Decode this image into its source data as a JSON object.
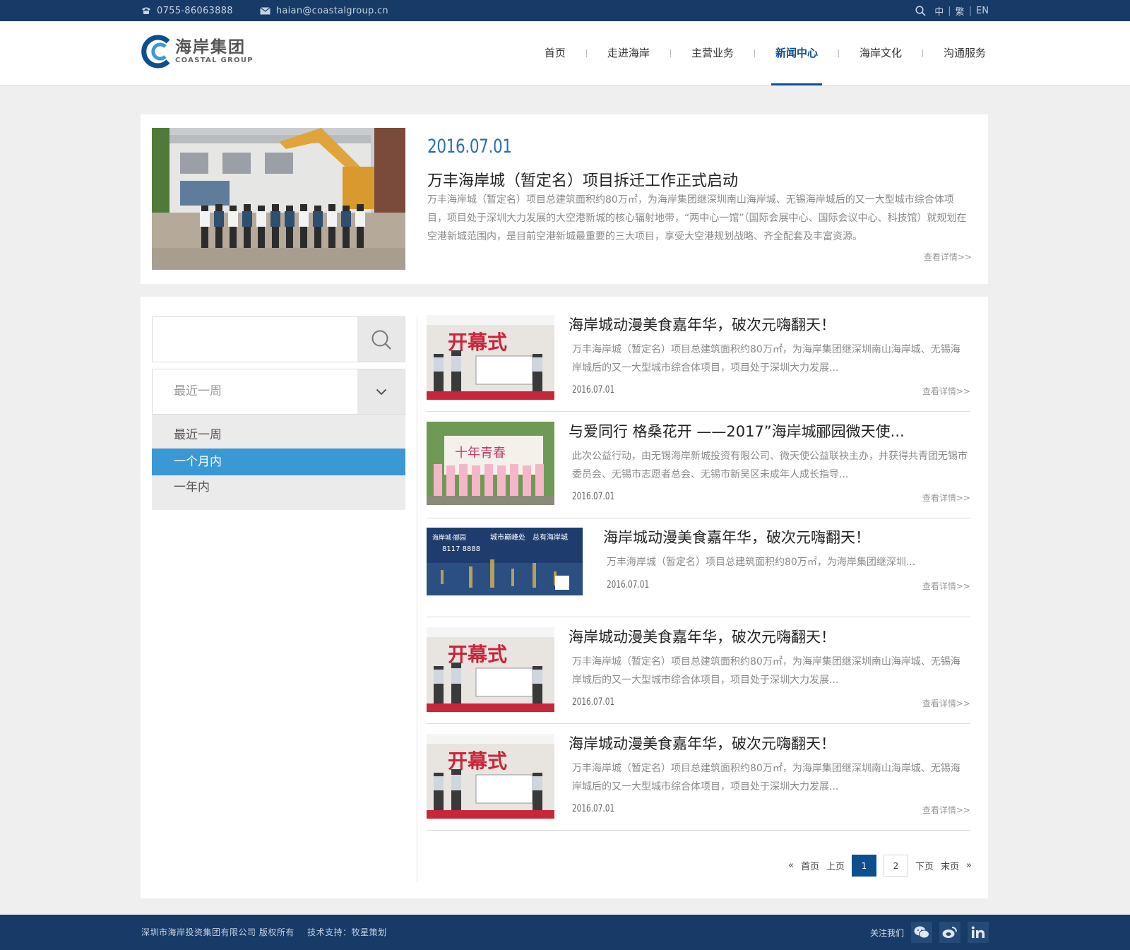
{
  "topbar": {
    "phone": "0755-86063888",
    "email": "haian@coastalgroup.cn",
    "lang": [
      "中",
      "繁",
      "EN"
    ]
  },
  "brand": {
    "name_cn": "海岸集团",
    "name_en": "COASTAL GROUP",
    "primary_color": "#173a66",
    "accent_color": "#0d4e8f",
    "highlight_color": "#3a98d4"
  },
  "nav": {
    "items": [
      {
        "label": "首页"
      },
      {
        "label": "走进海岸"
      },
      {
        "label": "主营业务"
      },
      {
        "label": "新闻中心"
      },
      {
        "label": "海岸文化"
      },
      {
        "label": "沟通服务"
      }
    ],
    "active": "新闻中心"
  },
  "featured": {
    "date": "2016.07.01",
    "title": "万丰海岸城（暂定名）项目拆迁工作正式启动",
    "desc": "万丰海岸城（暂定名）项目总建筑面积约80万㎡，为海岸集团继深圳南山海岸城、无锡海岸城后的又一大型城市综合体项目，项目处于深圳大力发展的大空港新城的核心辐射地带，“两中心一馆”（国际会展中心、国际会议中心、科技馆）就规划在空港新城范围内，是目前空港新城最重要的三大项目，享受大空港规划战略、齐全配套及丰富资源。",
    "more": "查看详情>>"
  },
  "filter": {
    "search_value": "",
    "selected": "最近一周",
    "options": [
      {
        "label": "最近一周"
      },
      {
        "label": "一个月内"
      },
      {
        "label": "一年内"
      }
    ],
    "active_option": "一个月内"
  },
  "news": [
    {
      "title": "海岸城动漫美食嘉年华，破次元嗨翻天！",
      "desc": "万丰海岸城（暂定名）项目总建筑面积约80万㎡，为海岸集团继深圳南山海岸城、无锡海岸城后的又一大型城市综合体项目，项目处于深圳大力发展...",
      "date": "2016.07.01",
      "more": "查看详情>>",
      "image": "opening-ceremony"
    },
    {
      "title": "与爱同行 格桑花开 ——2017”海岸城郦园微天使...",
      "desc": "此次公益行动，由无锡海岸新城投资有限公司、微天使公益联袂主办，并获得共青团无锡市委员会、无锡市志愿者总会、无锡市新吴区未成年人成长指导...",
      "date": "2016.07.01",
      "more": "查看详情>>",
      "image": "charity-event"
    },
    {
      "title": "海岸城动漫美食嘉年华，破次元嗨翻天！",
      "desc": "万丰海岸城（暂定名）项目总建筑面积约80万㎡，为海岸集团继深圳...",
      "date": "2016.07.01",
      "more": "查看详情>>",
      "image": "city-night-ad",
      "ad_text": [
        "海岸城·郦园",
        "城市巅峰处　总有海岸城",
        "8117 8888"
      ]
    },
    {
      "title": "海岸城动漫美食嘉年华，破次元嗨翻天！",
      "desc": "万丰海岸城（暂定名）项目总建筑面积约80万㎡，为海岸集团继深圳南山海岸城、无锡海岸城后的又一大型城市综合体项目，项目处于深圳大力发展...",
      "date": "2016.07.01",
      "more": "查看详情>>",
      "image": "opening-ceremony"
    },
    {
      "title": "海岸城动漫美食嘉年华，破次元嗨翻天！",
      "desc": "万丰海岸城（暂定名）项目总建筑面积约80万㎡，为海岸集团继深圳南山海岸城、无锡海岸城后的又一大型城市综合体项目，项目处于深圳大力发展...",
      "date": "2016.07.01",
      "more": "查看详情>>",
      "image": "opening-ceremony"
    }
  ],
  "ceremony_text": "开幕式",
  "charity_text": "十年青春",
  "pagination": {
    "first": "首页",
    "prev": "上页",
    "pages": [
      "1",
      "2"
    ],
    "current": "1",
    "next": "下页",
    "last": "末页",
    "first_arrow": "«",
    "last_arrow": "»"
  },
  "footer": {
    "copyright": "深圳市海岸投资集团有限公司  版权所有",
    "support": "技术支持：牧星策划",
    "follow": "关注我们",
    "social_icons": [
      "wechat-icon",
      "weibo-icon",
      "linkedin-icon"
    ]
  }
}
